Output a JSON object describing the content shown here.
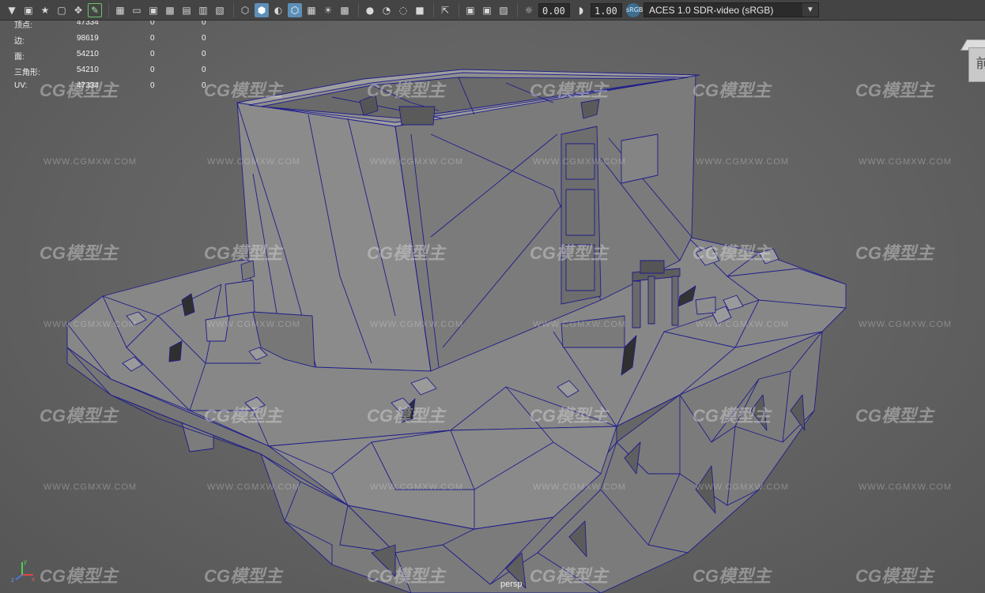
{
  "viewport": {
    "camera_name": "persp",
    "view_cube_face": "前",
    "axis_labels": {
      "x": "x",
      "y": "y",
      "z": "z"
    },
    "wire_color": "#1e1c8a",
    "surface_color": "#7f7f7f"
  },
  "toolbar": {
    "exposure_value": "0.00",
    "gamma_value": "1.00",
    "color_space": "ACES 1.0 SDR-video (sRGB)",
    "color_space_badge": "sRGB",
    "icons": [
      "camera-select-icon",
      "camera-attributes-icon",
      "bookmark-icon",
      "image-plane-icon",
      "grease-pencil-icon",
      "2d-pan-zoom-icon",
      "grid-icon",
      "film-gate-icon",
      "resolution-gate-icon",
      "gate-mask-icon",
      "field-chart-icon",
      "safe-action-icon",
      "safe-title-icon",
      "wireframe-icon",
      "smooth-shade-icon",
      "wireframe-on-shaded-icon",
      "textured-icon",
      "use-all-lights-icon",
      "shadows-icon",
      "screen-space-ao-icon",
      "motion-blur-icon",
      "multisample-aa-icon",
      "depth-of-field-icon",
      "isolate-select-icon",
      "xray-icon",
      "xray-joints-icon",
      "xray-components-icon",
      "exposure-icon",
      "gamma-icon",
      "color-management-icon"
    ]
  },
  "hud": {
    "rows": [
      {
        "label": "顶点:",
        "values": [
          "47334",
          "0",
          "0"
        ]
      },
      {
        "label": "边:",
        "values": [
          "98619",
          "0",
          "0"
        ]
      },
      {
        "label": "面:",
        "values": [
          "54210",
          "0",
          "0"
        ]
      },
      {
        "label": "三角形:",
        "values": [
          "54210",
          "0",
          "0"
        ]
      },
      {
        "label": "UV:",
        "values": [
          "47334",
          "0",
          "0"
        ]
      }
    ]
  },
  "watermark": {
    "logo_text": "CG模型主",
    "url_text": "WWW.CGMXW.COM"
  }
}
